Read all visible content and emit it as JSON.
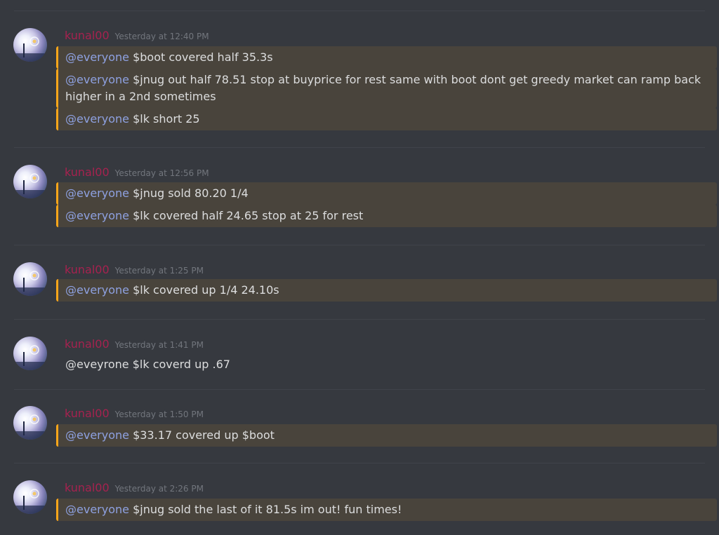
{
  "author": "kunal00",
  "mention": "@everyone",
  "colors": {
    "background": "#36393f",
    "username": "#a6224f",
    "mention": "#8ea1e1",
    "highlight_bg": "#49443c",
    "highlight_border": "#faa61a",
    "timestamp": "#72767d"
  },
  "groups": [
    {
      "timestamp": "Yesterday at 12:40 PM",
      "messages": [
        {
          "mention": "@everyone",
          "text": " $boot covered half 35.3s"
        },
        {
          "mention": "@everyone",
          "text": " $jnug out half 78.51 stop at buyprice for rest same with boot dont get greedy market can ramp back higher in a 2nd sometimes"
        },
        {
          "mention": "@everyone",
          "text": " $lk short 25"
        }
      ]
    },
    {
      "timestamp": "Yesterday at 12:56 PM",
      "messages": [
        {
          "mention": "@everyone",
          "text": " $jnug sold 80.20 1/4"
        },
        {
          "mention": "@everyone",
          "text": " $lk covered half 24.65 stop at 25 for rest"
        }
      ]
    },
    {
      "timestamp": "Yesterday at 1:25 PM",
      "messages": [
        {
          "mention": "@everyone",
          "text": " $lk covered up 1/4  24.10s"
        }
      ]
    },
    {
      "timestamp": "Yesterday at 1:41 PM",
      "messages": [
        {
          "mention": "",
          "text": "@eveyrone $lk coverd up .67"
        }
      ]
    },
    {
      "timestamp": "Yesterday at 1:50 PM",
      "messages": [
        {
          "mention": "@everyone",
          "text": " $33.17  covered up $boot"
        }
      ]
    },
    {
      "timestamp": "Yesterday at 2:26 PM",
      "messages": [
        {
          "mention": "@everyone",
          "text": " $jnug sold the last of it 81.5s   im out! fun times!"
        }
      ]
    }
  ]
}
